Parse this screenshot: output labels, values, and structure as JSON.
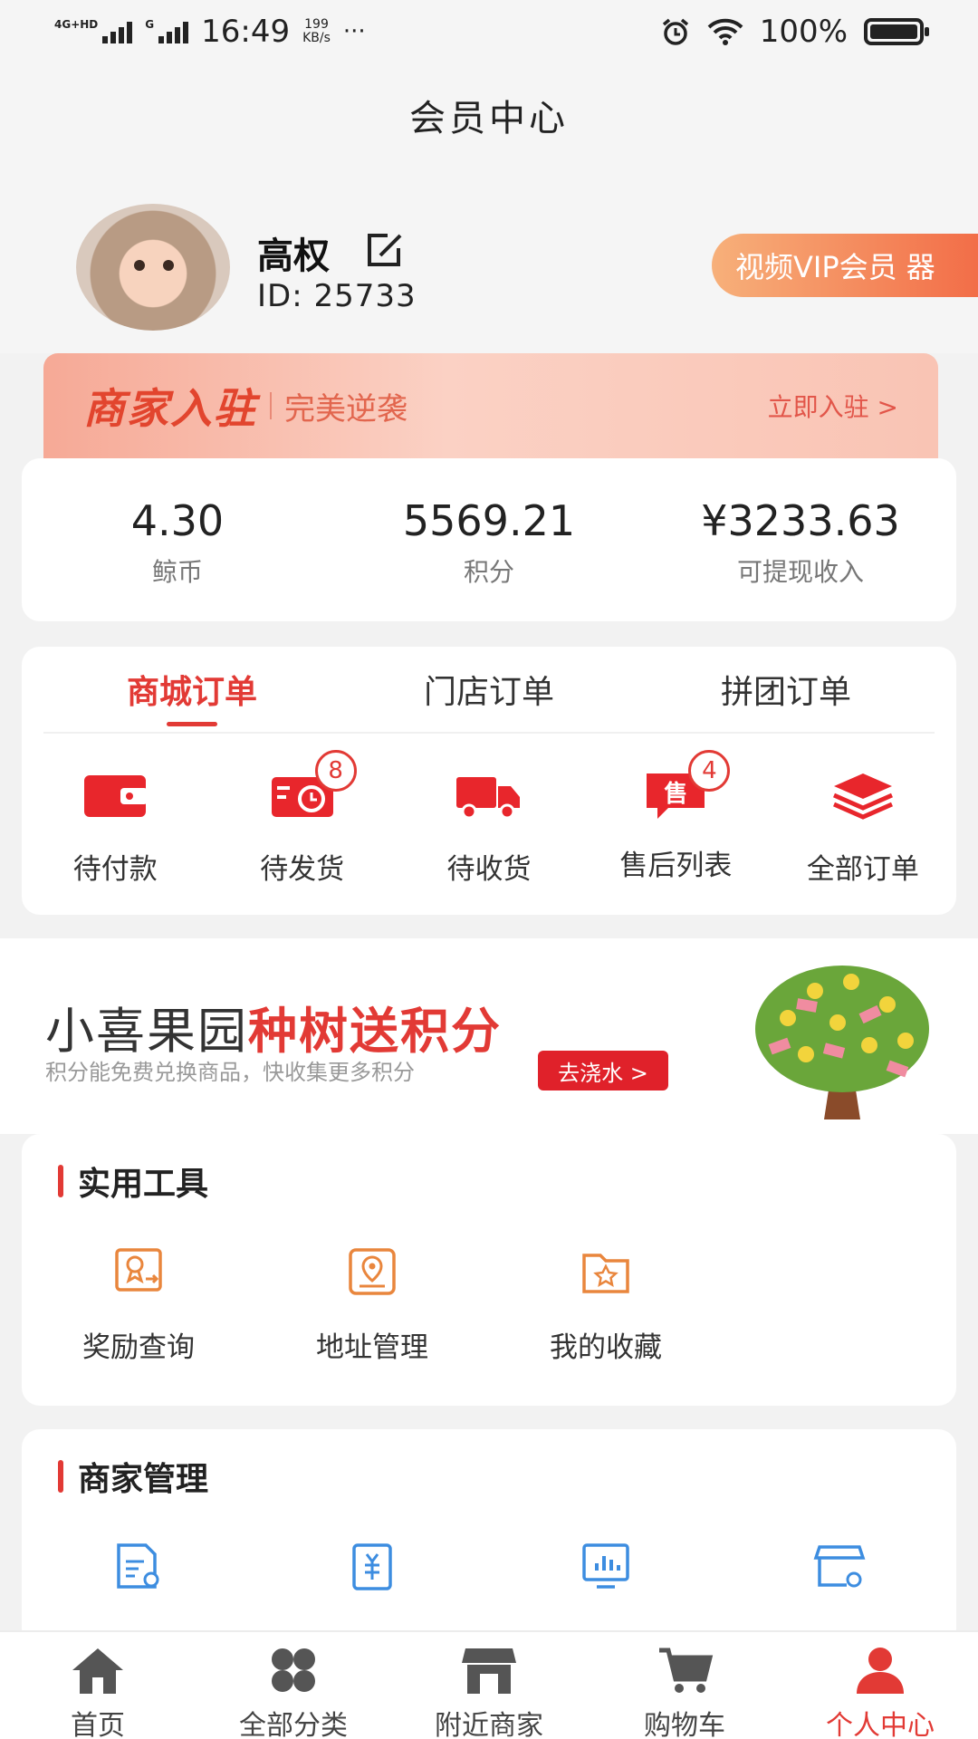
{
  "status_bar": {
    "network1": "4G+HD",
    "network2": "G",
    "time": "16:49",
    "speed_value": "199",
    "speed_unit": "KB/s",
    "more": "···",
    "battery": "100%"
  },
  "header": {
    "title": "会员中心",
    "user_name": "高权",
    "user_id": "ID: 25733",
    "vip_button": "视频VIP会员 器"
  },
  "merchant_banner": {
    "headline": "商家入驻",
    "subline": "完美逆袭",
    "cta": "立即入驻 >"
  },
  "stats": [
    {
      "value": "4.30",
      "label": "鲸币"
    },
    {
      "value": "5569.21",
      "label": "积分"
    },
    {
      "value": "¥3233.63",
      "label": "可提现收入"
    }
  ],
  "orders": {
    "tabs": [
      "商城订单",
      "门店订单",
      "拼团订单"
    ],
    "items": [
      {
        "label": "待付款",
        "icon": "wallet-icon",
        "badge": ""
      },
      {
        "label": "待发货",
        "icon": "pending-ship-icon",
        "badge": "8"
      },
      {
        "label": "待收货",
        "icon": "truck-icon",
        "badge": ""
      },
      {
        "label": "售后列表",
        "icon": "after-sale-icon",
        "badge": "4",
        "icon_text": "售"
      },
      {
        "label": "全部订单",
        "icon": "layers-icon",
        "badge": ""
      }
    ]
  },
  "orchard": {
    "title_plain": "小喜果园",
    "title_red": "种树送积分",
    "desc": "积分能免费兑换商品，快收集更多积分",
    "button": "去浇水 >"
  },
  "tools": {
    "title": "实用工具",
    "items": [
      {
        "label": "奖励查询",
        "icon": "award-icon"
      },
      {
        "label": "地址管理",
        "icon": "location-icon"
      },
      {
        "label": "我的收藏",
        "icon": "favorite-folder-icon"
      }
    ]
  },
  "merchant_mgmt": {
    "title": "商家管理",
    "items": [
      {
        "label": "",
        "icon": "document-settings-icon"
      },
      {
        "label": "",
        "icon": "finance-icon"
      },
      {
        "label": "",
        "icon": "chart-icon"
      },
      {
        "label": "",
        "icon": "store-settings-icon"
      }
    ]
  },
  "bottom_nav": [
    {
      "label": "首页",
      "icon": "home-icon"
    },
    {
      "label": "全部分类",
      "icon": "category-icon"
    },
    {
      "label": "附近商家",
      "icon": "store-icon"
    },
    {
      "label": "购物车",
      "icon": "cart-icon"
    },
    {
      "label": "个人中心",
      "icon": "user-icon",
      "active": true
    }
  ],
  "colors": {
    "accent": "#e23a35",
    "icon_orange": "#e9863d",
    "icon_blue": "#3d8de0"
  }
}
